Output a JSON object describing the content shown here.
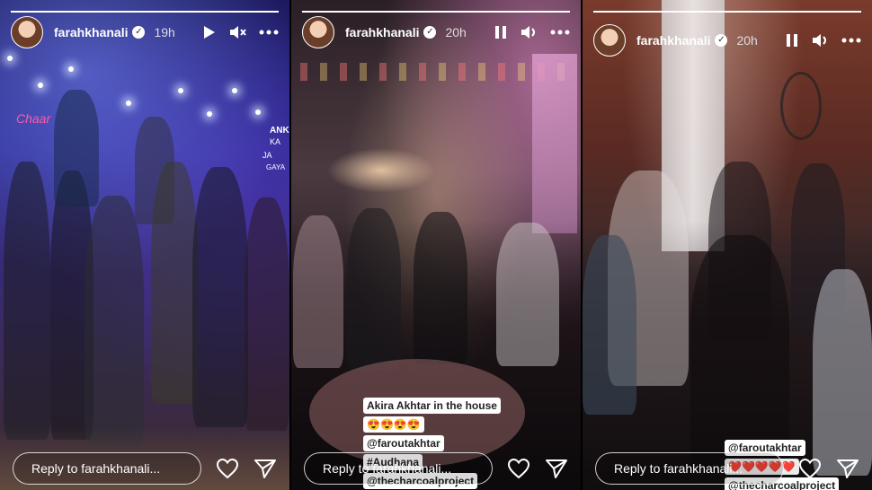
{
  "stories": [
    {
      "username": "farahkhanali",
      "time": "19h",
      "state": "playing",
      "progress": 1.0,
      "reply_placeholder": "Reply to farahkhanali...",
      "stage_signs": [
        "Chaar",
        "ANKA",
        "KA",
        "JA",
        "GAYA"
      ]
    },
    {
      "username": "farahkhanali",
      "time": "20h",
      "state": "paused",
      "progress": 1.0,
      "reply_placeholder": "Reply to farahkhanali...",
      "caption": [
        "Akira Akhtar in the house",
        "😍😍😍😍",
        "@faroutakhtar",
        "#Audhana",
        "@thecharcoalproject"
      ]
    },
    {
      "username": "farahkhanali",
      "time": "20h",
      "state": "paused",
      "progress": 1.0,
      "reply_placeholder": "Reply to farahkhanali...",
      "caption": [
        "@faroutakhtar",
        "❤️❤️❤️❤️❤️",
        "@thecharcoalproject"
      ]
    }
  ],
  "icons": {
    "play": "play-icon",
    "pause": "pause-icon",
    "mute": "mute-icon",
    "volume": "volume-icon",
    "more": "more-icon",
    "like": "heart-icon",
    "share": "send-icon",
    "verified": "verified-badge-icon"
  }
}
